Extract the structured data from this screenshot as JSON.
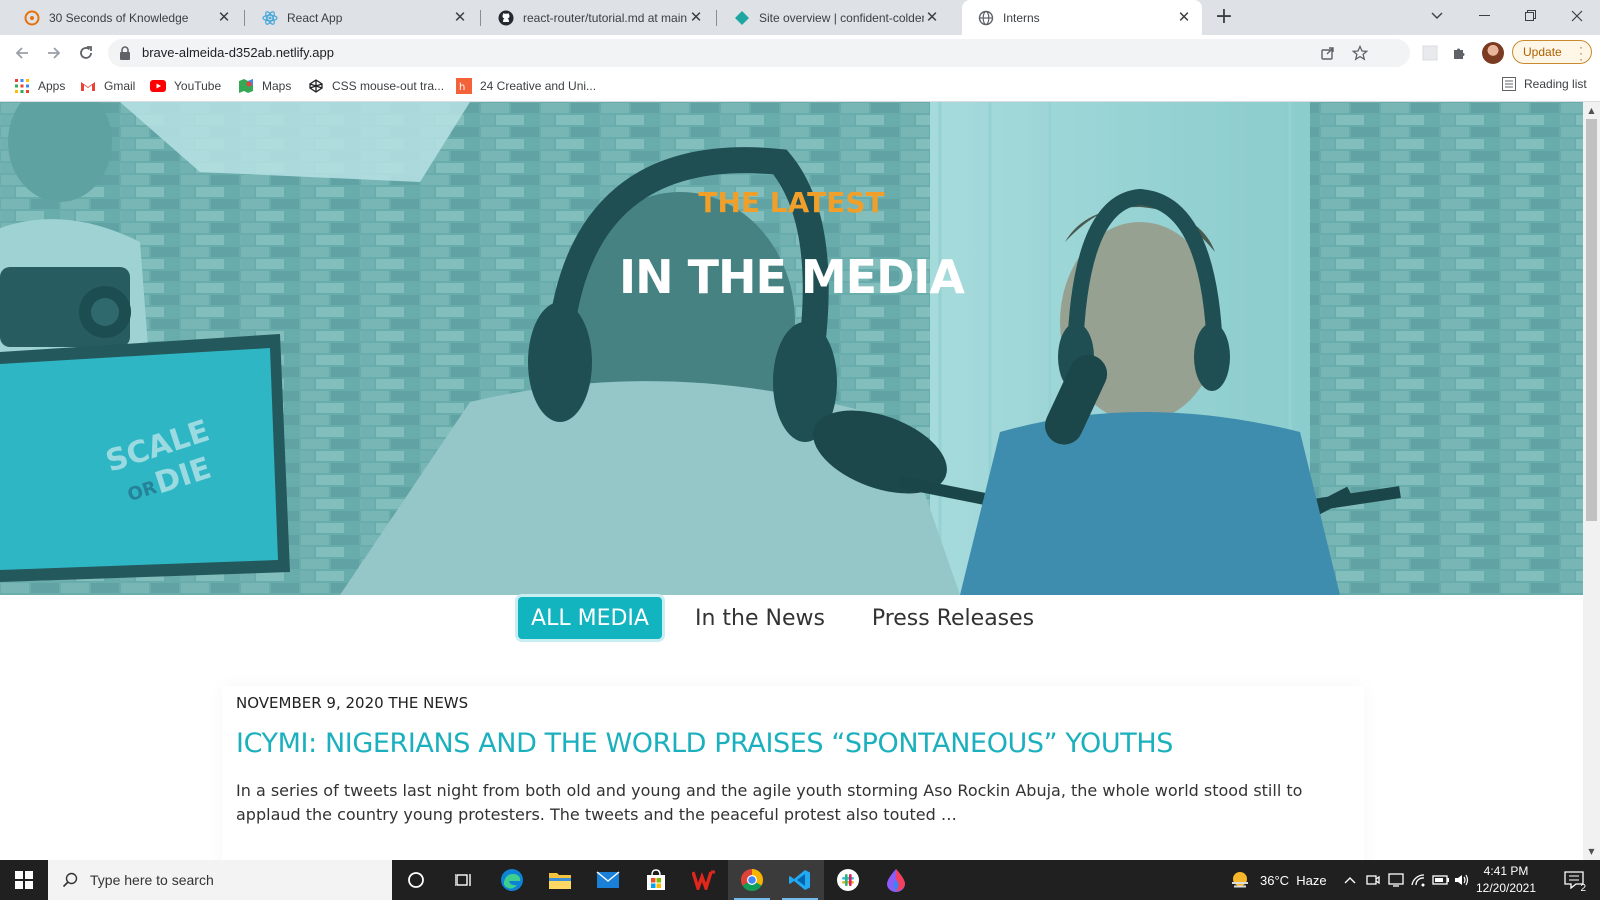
{
  "browser": {
    "tabs": [
      {
        "title": "30 Seconds of Knowledge",
        "icon": "knowledge-icon"
      },
      {
        "title": "React App",
        "icon": "react-icon"
      },
      {
        "title": "react-router/tutorial.md at main",
        "icon": "github-icon"
      },
      {
        "title": "Site overview | confident-colden-",
        "icon": "netlify-icon"
      },
      {
        "title": "Interns",
        "icon": "globe-icon",
        "active": true
      }
    ],
    "url": "brave-almeida-d352ab.netlify.app",
    "update_label": "Update",
    "bookmarks": [
      {
        "label": "Apps",
        "icon": "apps-grid-icon"
      },
      {
        "label": "Gmail",
        "icon": "gmail-icon"
      },
      {
        "label": "YouTube",
        "icon": "youtube-icon"
      },
      {
        "label": "Maps",
        "icon": "maps-icon"
      },
      {
        "label": "CSS mouse-out tra...",
        "icon": "codepen-icon"
      },
      {
        "label": "24 Creative and Uni...",
        "icon": "bookmark-site-icon"
      }
    ],
    "reading_list": "Reading list"
  },
  "page": {
    "hero": {
      "kicker": "THE LATEST",
      "title": "IN THE MEDIA",
      "sign_text": "SCALE OR DIE"
    },
    "filters": [
      {
        "label": "ALL MEDIA",
        "active": true
      },
      {
        "label": "In the News",
        "active": false
      },
      {
        "label": "Press Releases",
        "active": false
      }
    ],
    "article": {
      "meta": "NOVEMBER 9, 2020 THE NEWS",
      "title": "ICYMI: NIGERIANS AND THE WORLD PRAISES “SPONTANEOUS” YOUTHS",
      "excerpt": "In a series of tweets last night from both old and young and the agile youth storming Aso Rockin Abuja, the whole world stood still to applaud the country young protesters. The tweets and the peaceful protest also touted …"
    },
    "colors": {
      "accent": "#12b4c0",
      "kicker": "#f0a02a",
      "title_link": "#1ab0bd"
    }
  },
  "taskbar": {
    "search_placeholder": "Type here to search",
    "weather": "36°C  Haze",
    "time": "4:41 PM",
    "date": "12/20/2021",
    "notification_count": "2"
  }
}
